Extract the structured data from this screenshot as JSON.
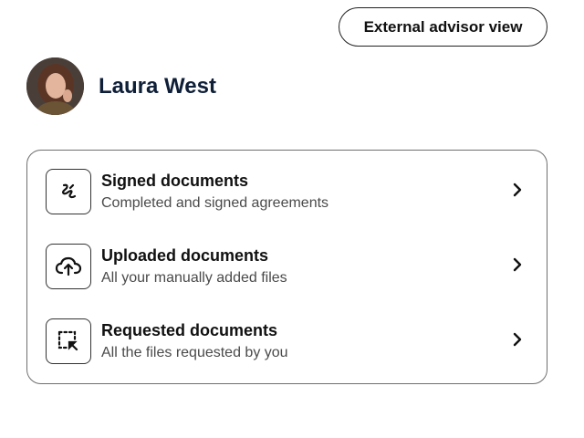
{
  "header": {
    "advisor_button_label": "External advisor view"
  },
  "profile": {
    "name": "Laura West",
    "avatar_icon": "user-photo"
  },
  "documents": {
    "items": [
      {
        "title": "Signed documents",
        "subtitle": "Completed and signed agreements",
        "icon": "signature-icon"
      },
      {
        "title": "Uploaded documents",
        "subtitle": "All your manually added files",
        "icon": "cloud-upload-icon"
      },
      {
        "title": "Requested documents",
        "subtitle": "All the files requested by you",
        "icon": "request-select-icon"
      }
    ]
  },
  "colors": {
    "name_text": "#0f1f38",
    "border": "#6f6f6f",
    "subtitle_text": "#4a4a4a"
  }
}
